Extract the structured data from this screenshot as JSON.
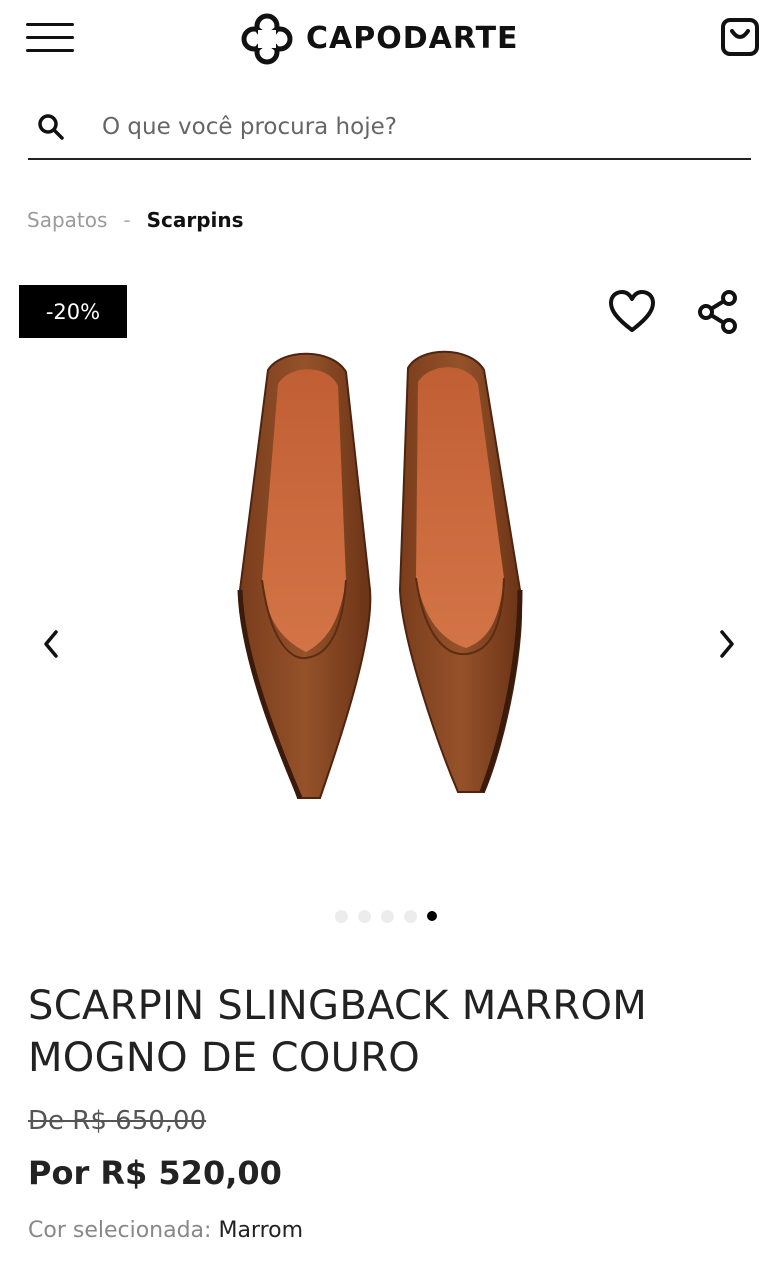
{
  "header": {
    "brand": "CAPODARTE",
    "icons": {
      "menu": "hamburger-icon",
      "logo": "clover-logo-icon",
      "cart": "shopping-bag-icon"
    }
  },
  "search": {
    "placeholder": "O que você procura hoje?",
    "value": ""
  },
  "breadcrumb": {
    "items": [
      "Sapatos",
      "Scarpins"
    ],
    "separator": "-"
  },
  "product": {
    "discount_badge": "-20%",
    "title": "SCARPIN SLINGBACK MARROM MOGNO DE COURO",
    "old_price": "De R$ 650,00",
    "price": "Por R$ 520,00",
    "color_label": "Cor selecionada:",
    "color_value": "Marrom",
    "gallery": {
      "count": 5,
      "active_index": 4
    }
  },
  "colors": {
    "accent": "#000000",
    "shoe": "#8a4a24",
    "insole": "#c9683a"
  }
}
